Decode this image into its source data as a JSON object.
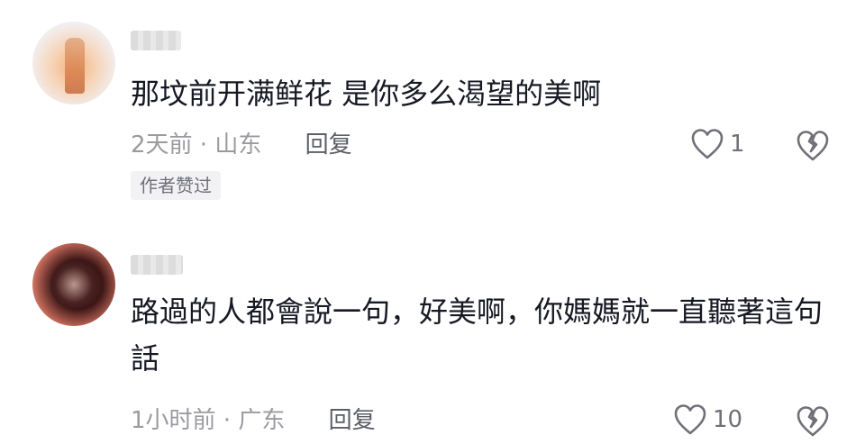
{
  "comments": [
    {
      "text": "那坟前开满鲜花 是你多么渴望的美啊",
      "time_location": "2天前 · 山东",
      "reply_label": "回复",
      "like_count": "1",
      "tag": "作者赞过"
    },
    {
      "text": "路過的人都會說一句，好美啊，你媽媽就一直聽著這句話",
      "time_location": "1小时前 · 广东",
      "reply_label": "回复",
      "like_count": "10"
    }
  ],
  "colors": {
    "text": "#161823",
    "meta": "#9a9ba1",
    "icon": "#6f7078"
  },
  "icons": [
    "heart-icon",
    "broken-heart-icon"
  ]
}
